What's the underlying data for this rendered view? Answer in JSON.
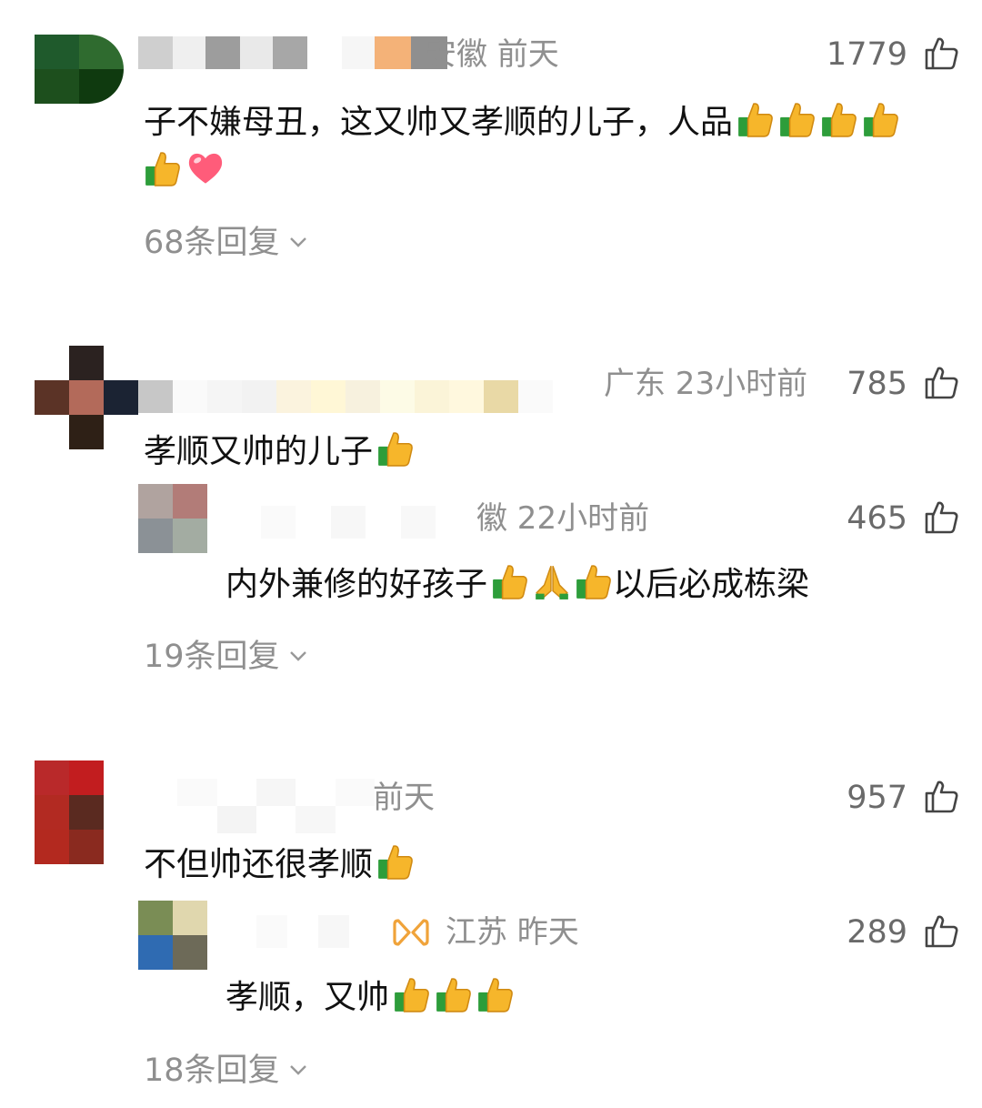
{
  "comments": [
    {
      "meta": "安徽 前天",
      "likes": "1779",
      "text": "子不嫌母丑，这又帅又孝顺的儿子，人品",
      "replies_label": "68条回复"
    },
    {
      "meta": "广东 23小时前",
      "likes": "785",
      "text": "孝顺又帅的儿子",
      "reply": {
        "meta": "徽 22小时前",
        "likes": "465",
        "text_a": "内外兼修的好孩子",
        "text_b": "以后必成栋梁"
      },
      "replies_label": "19条回复"
    },
    {
      "meta": "前天",
      "likes": "957",
      "text": "不但帅还很孝顺",
      "reply": {
        "meta": "江苏 昨天",
        "likes": "289",
        "text": "孝顺，又帅"
      },
      "replies_label": "18条回复"
    }
  ],
  "icons": {
    "like": "thumbs-up-outline-icon",
    "emoji_thumb": "thumbs-up-emoji",
    "emoji_heart": "heart-emoji",
    "emoji_pray": "folded-hands-emoji",
    "badge": "vip-badge-icon",
    "chevron": "chevron-down-icon"
  },
  "colors": {
    "meta_text": "#8f8f8f",
    "like_count": "#6a6a6a",
    "badge": "#f0a33a"
  }
}
